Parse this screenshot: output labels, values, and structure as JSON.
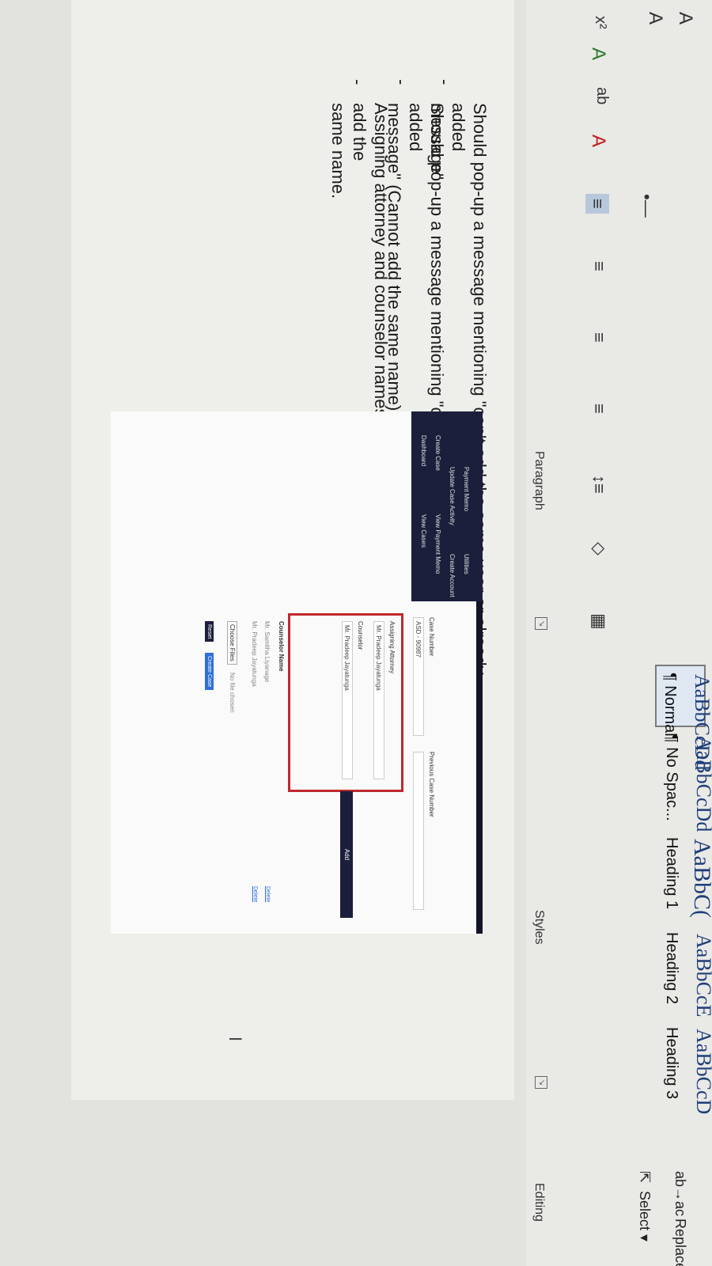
{
  "ribbon": {
    "styles": [
      {
        "preview": "AaBbCcDd",
        "label": "¶ Normal"
      },
      {
        "preview": "AaBbCcDd",
        "label": "¶ No Spac..."
      },
      {
        "preview": "AaBbC(",
        "label": "Heading 1"
      },
      {
        "preview": "AaBbCcE",
        "label": "Heading 2"
      },
      {
        "preview": "AaBbCcD",
        "label": "Heading 3"
      }
    ],
    "paragraph_label": "Paragraph",
    "styles_label": "Styles",
    "editing_label": "Editing",
    "replace_label": "Replace",
    "select_label": "Select ▾",
    "replace_icon_text": "ab\nac"
  },
  "document": {
    "bullets": [
      {
        "lines": [
          "Should pop-up a message mentioning \"can't add the same user or already added",
          "message\""
        ]
      },
      {
        "lines": [
          "Should pop-up a message mentioning \"can't add the same user or already added",
          "message\" (Cannot add the same name)"
        ]
      },
      {
        "lines": [
          "Assigning attorney and counselor names should need to be different. Cannot add the",
          "same name."
        ]
      }
    ]
  },
  "screenshot": {
    "sidebar": {
      "items": [
        "Dashboard",
        "Create Case",
        "Update Case Activity",
        "Payment Memo",
        "View Cases",
        "View Payment Memo",
        "Create Account",
        "Utilities"
      ]
    },
    "case_number_label": "Case Number",
    "case_number_value": "ASD - 90987",
    "previous_case_label": "Previous Case Number",
    "assigning_attorney_label": "Assigning Attorney",
    "assigning_attorney_value": "Mr. Pradeep Jayatunga",
    "counselor_label": "Counselor",
    "counselor_value": "Mr. Pradeep Jayatunga",
    "add_label": "Add",
    "counselor_name_header": "Counselor Name",
    "counselor_rows": [
      {
        "name": "Mr. Samitha Liyanage",
        "action": "Delete"
      },
      {
        "name": "Mr. Pradeep Jayatunga",
        "action": "Delete"
      }
    ],
    "choose_files_label": "Choose Files",
    "no_file_label": "No file chosen",
    "reset_label": "Reset",
    "create_case_label": "Create Case"
  }
}
